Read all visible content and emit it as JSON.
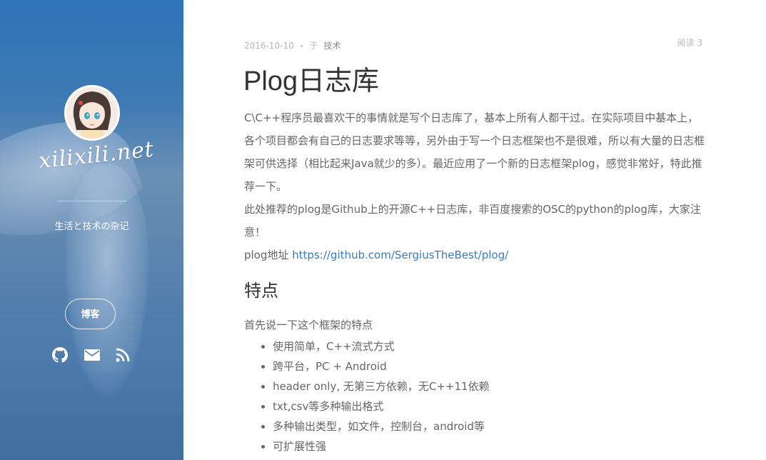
{
  "sidebar": {
    "site_title": "xilixili.net",
    "subtitle": "生活と技术の杂记",
    "blog_button": "博客",
    "social_icons": [
      "github-icon",
      "mail-icon",
      "rss-icon"
    ],
    "accent_color": "#2f74b8"
  },
  "post": {
    "date": "2016-10-10",
    "separator": "•",
    "in_label": "于",
    "category": "技术",
    "reads": "阅读 3",
    "title": "Plog日志库",
    "intro": "C\\C++程序员最喜欢干的事情就是写个日志库了，基本上所有人都干过。在实际项目中基本上，各个项目都会有自己的日志要求等等，另外由于写一个日志框架也不是很难，所以有大量的日志框架可供选择（相比起来Java就少的多）。最近应用了一个新的日志框架plog，感觉非常好，特此推荐一下。",
    "recommend": "此处推荐的plog是Github上的开源C++日志库，非百度搜索的OSC的python的plog库，大家注意！",
    "address_label": "plog地址 ",
    "address_link": "https://github.com/SergiusTheBest/plog/",
    "features_heading": "特点",
    "features_intro": "首先说一下这个框架的特点",
    "features": [
      "使用简单，C++流式方式",
      "跨平台，PC + Android",
      "header only, 无第三方依赖，无C++11依赖",
      "txt,csv等多种输出格式",
      "多种输出类型，如文件，控制台，android等",
      "可扩展性强"
    ]
  }
}
